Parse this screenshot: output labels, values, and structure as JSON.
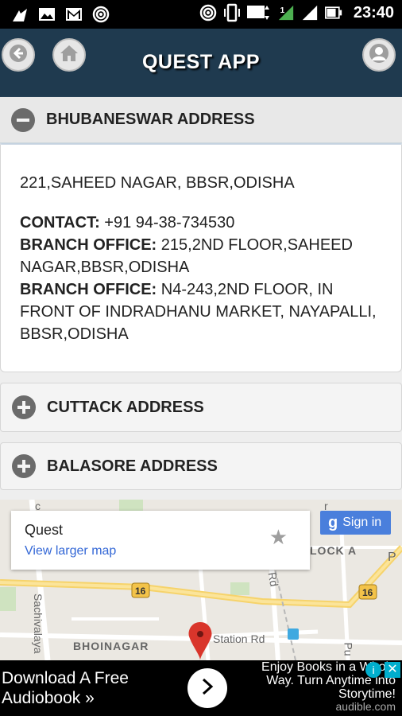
{
  "status_bar": {
    "time": "23:40",
    "network_label": "4G",
    "sim_label": "2",
    "left_icons": [
      "app-icon",
      "gallery-icon",
      "gmail-icon",
      "hotspot-icon"
    ],
    "right_icons": [
      "hotspot-icon",
      "vibrate-icon",
      "signal-icon",
      "battery-icon"
    ]
  },
  "header": {
    "title": "QUEST APP",
    "back_icon": "back-arrow-icon",
    "home_icon": "home-icon",
    "user_icon": "user-icon"
  },
  "accordion": [
    {
      "title": "BHUBANESWAR ADDRESS",
      "expanded": true
    },
    {
      "title": "CUTTACK ADDRESS",
      "expanded": false
    },
    {
      "title": "BALASORE ADDRESS",
      "expanded": false
    }
  ],
  "bhubaneswar": {
    "address": "221,SAHEED NAGAR, BBSR,ODISHA",
    "contact_label": "CONTACT:",
    "contact_value": " +91 94-38-734530",
    "branch1_label": "BRANCH OFFICE:",
    "branch1_value": " 215,2ND FLOOR,SAHEED NAGAR,BBSR,ODISHA",
    "branch2_label": "BRANCH OFFICE:",
    "branch2_value": " N4-243,2ND FLOOR, IN FRONT OF INDRADHANU MARKET, NAYAPALLI, BBSR,ODISHA"
  },
  "map": {
    "place_name": "Quest",
    "view_larger": "View larger map",
    "sign_in_g": "g",
    "sign_in": "Sign in",
    "labels": {
      "bhoinagar": "BHOINAGAR",
      "station_rd": "Station Rd",
      "sachivalaya": "Sachivalaya",
      "block_a": "LOCK A",
      "highway": "16",
      "ra": "r Rd",
      "pu": "Pu",
      "p": "P",
      "c": "c",
      "r": "r"
    }
  },
  "ad": {
    "left_text_1": "Download A Free",
    "left_text_2": "Audiobook »",
    "right_text_1": "Enjoy Books in a Whole",
    "right_text_2": "Way. Turn Anytime into",
    "right_text_3": "Storytime!",
    "domain": "audible.com",
    "info": "i",
    "close": "✕"
  },
  "colors": {
    "header_bg": "#1f3a4f",
    "sign_in_bg": "#4a7fdc",
    "link": "#3367d6",
    "marker": "#d9352b"
  }
}
